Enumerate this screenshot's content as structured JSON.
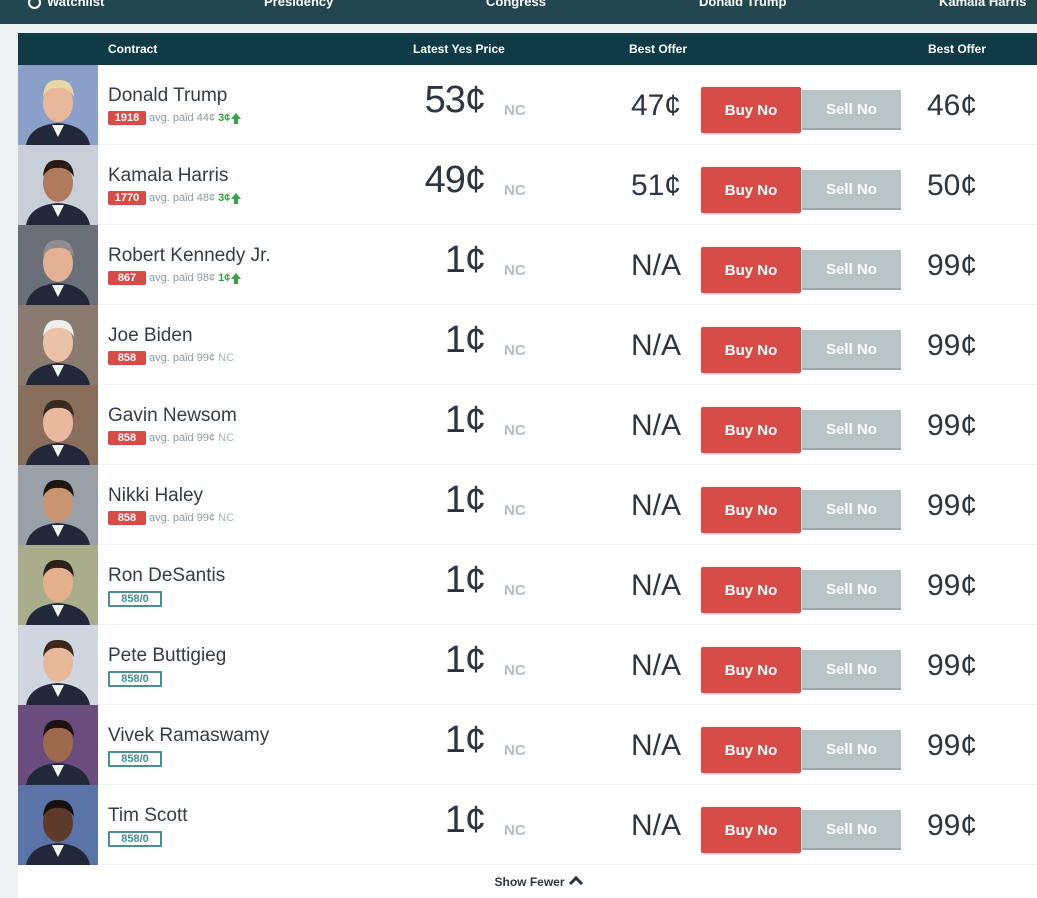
{
  "nav": {
    "items": [
      "Watchlist",
      "Presidency",
      "Congress",
      "Donald Trump",
      "Kamala Harris"
    ]
  },
  "table": {
    "headers": {
      "contract": "Contract",
      "latest_yes_price": "Latest Yes Price",
      "best_offer_no": "Best Offer",
      "best_offer_yes": "Best Offer"
    },
    "buy_label": "Buy No",
    "sell_label": "Sell No",
    "rows": [
      {
        "name": "Donald Trump",
        "shares": "1918",
        "avg": "avg. paid 44¢",
        "change": "3¢",
        "direction": "up",
        "price": "53¢",
        "nc": "NC",
        "no_offer": "47¢",
        "yes_offer": "46¢"
      },
      {
        "name": "Kamala Harris",
        "shares": "1770",
        "avg": "avg. paid 48¢",
        "change": "3¢",
        "direction": "up",
        "price": "49¢",
        "nc": "NC",
        "no_offer": "51¢",
        "yes_offer": "50¢"
      },
      {
        "name": "Robert Kennedy Jr.",
        "shares": "867",
        "avg": "avg. paid 98¢",
        "change": "1¢",
        "direction": "up",
        "price": "1¢",
        "nc": "NC",
        "no_offer": "N/A",
        "yes_offer": "99¢"
      },
      {
        "name": "Joe Biden",
        "shares": "858",
        "avg": "avg. paid 99¢",
        "change": "NC",
        "direction": "none",
        "price": "1¢",
        "nc": "NC",
        "no_offer": "N/A",
        "yes_offer": "99¢"
      },
      {
        "name": "Gavin Newsom",
        "shares": "858",
        "avg": "avg. paid 99¢",
        "change": "NC",
        "direction": "none",
        "price": "1¢",
        "nc": "NC",
        "no_offer": "N/A",
        "yes_offer": "99¢"
      },
      {
        "name": "Nikki Haley",
        "shares": "858",
        "avg": "avg. paid 99¢",
        "change": "NC",
        "direction": "none",
        "price": "1¢",
        "nc": "NC",
        "no_offer": "N/A",
        "yes_offer": "99¢"
      },
      {
        "name": "Ron DeSantis",
        "badge": "858/0",
        "price": "1¢",
        "nc": "NC",
        "no_offer": "N/A",
        "yes_offer": "99¢"
      },
      {
        "name": "Pete Buttigieg",
        "badge": "858/0",
        "price": "1¢",
        "nc": "NC",
        "no_offer": "N/A",
        "yes_offer": "99¢"
      },
      {
        "name": "Vivek Ramaswamy",
        "badge": "858/0",
        "price": "1¢",
        "nc": "NC",
        "no_offer": "N/A",
        "yes_offer": "99¢"
      },
      {
        "name": "Tim Scott",
        "badge": "858/0",
        "price": "1¢",
        "nc": "NC",
        "no_offer": "N/A",
        "yes_offer": "99¢"
      }
    ]
  },
  "footer": {
    "show_fewer": "Show Fewer"
  },
  "colors": {
    "header_bg": "#0e3b45",
    "buy_red": "#d84b47",
    "sell_gray": "#b8c4c6",
    "up_green": "#37a24b",
    "badge_teal": "#4d8b95"
  }
}
